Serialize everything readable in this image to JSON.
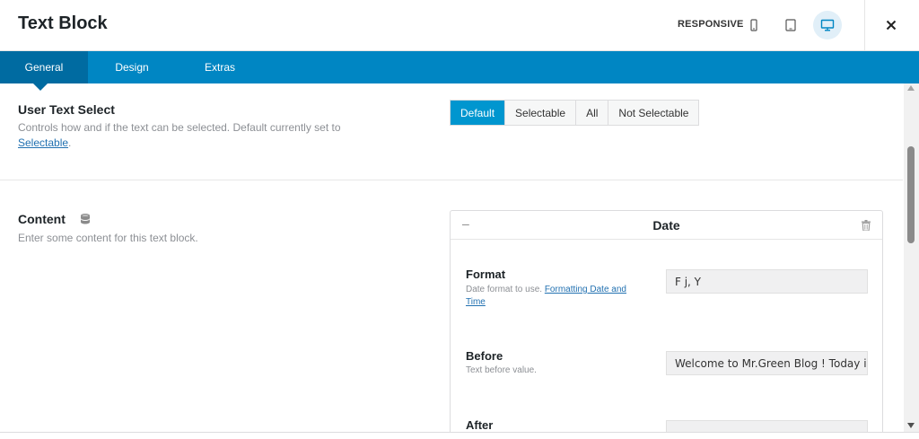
{
  "header": {
    "title": "Text Block",
    "responsive_label": "RESPONSIVE"
  },
  "tabs": [
    {
      "label": "General",
      "active": true
    },
    {
      "label": "Design",
      "active": false
    },
    {
      "label": "Extras",
      "active": false
    }
  ],
  "user_text_select": {
    "title": "User Text Select",
    "desc_prefix": "Controls how and if the text can be selected. Default currently set to ",
    "desc_link": "Selectable",
    "desc_suffix": ".",
    "options": [
      "Default",
      "Selectable",
      "All",
      "Not Selectable"
    ],
    "selected": "Default"
  },
  "content": {
    "title": "Content",
    "desc": "Enter some content for this text block."
  },
  "date_card": {
    "collapse_symbol": "–",
    "title": "Date",
    "fields": {
      "format": {
        "label": "Format",
        "desc_prefix": "Date format to use. ",
        "desc_link": "Formatting Date and Time",
        "value": "F j, Y"
      },
      "before": {
        "label": "Before",
        "desc": "Text before value.",
        "value": "Welcome to Mr.Green Blog ! Today is :"
      },
      "after": {
        "label": "After",
        "value": ""
      }
    }
  },
  "colors": {
    "accent": "#0086c3",
    "accent_dark": "#006ba1",
    "selected_button": "#0096cf",
    "link": "#2271b1"
  }
}
